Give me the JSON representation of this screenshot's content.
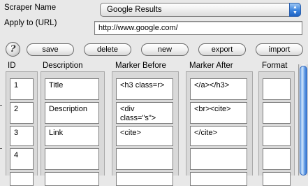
{
  "form": {
    "scraper_name_label": "Scraper Name",
    "scraper_name_value": "Google Results",
    "apply_label": "Apply to (URL)",
    "url_value": "http://www.google.com/"
  },
  "toolbar": {
    "help_glyph": "?",
    "save": "save",
    "delete": "delete",
    "new": "new",
    "export": "export",
    "import": "import"
  },
  "table": {
    "headers": {
      "id": "ID",
      "description": "Description",
      "marker_before": "Marker Before",
      "marker_after": "Marker After",
      "format": "Format"
    },
    "rows": [
      {
        "id": "1",
        "description": "Title",
        "marker_before": "<h3 class=r>",
        "marker_after": "</a></h3>",
        "format": ""
      },
      {
        "id": "2",
        "description": "Description",
        "marker_before": "<div\nclass=\"s\">",
        "marker_after": "<br><cite>",
        "format": ""
      },
      {
        "id": "3",
        "description": "Link",
        "marker_before": "<cite>",
        "marker_after": "</cite>",
        "format": ""
      },
      {
        "id": "4",
        "description": "",
        "marker_before": "",
        "marker_after": "",
        "format": ""
      },
      {
        "id": "",
        "description": "",
        "marker_before": "",
        "marker_after": "",
        "format": ""
      }
    ]
  },
  "icons": {
    "help": "help-icon",
    "dropdown": "updown-arrows-icon"
  },
  "colors": {
    "accent": "#3b83dd",
    "window_bg": "#e8e8e8"
  }
}
